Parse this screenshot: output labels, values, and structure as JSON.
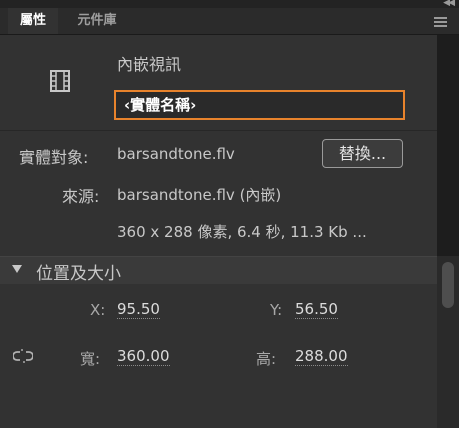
{
  "tabs": {
    "properties": "屬性",
    "library": "元件庫"
  },
  "symbol": {
    "type": "內嵌視訊",
    "instance_name_placeholder": "‹實體名稱›"
  },
  "instance": {
    "label": "實體對象:",
    "value": "barsandtone.flv",
    "swap_button": "替換..."
  },
  "source": {
    "label": "來源:",
    "value": "barsandtone.flv (內嵌)",
    "details": "360 x 288 像素, 6.4 秒, 11.3 Kb ..."
  },
  "position_size": {
    "title": "位置及大小",
    "x_label": "X:",
    "x_value": "95.50",
    "y_label": "Y:",
    "y_value": "56.50",
    "w_label": "寬:",
    "w_value": "360.00",
    "h_label": "高:",
    "h_value": "288.00"
  },
  "icons": [
    "collapse-icon",
    "panel-menu-icon",
    "film-icon",
    "section-collapse-icon",
    "link-icon"
  ]
}
